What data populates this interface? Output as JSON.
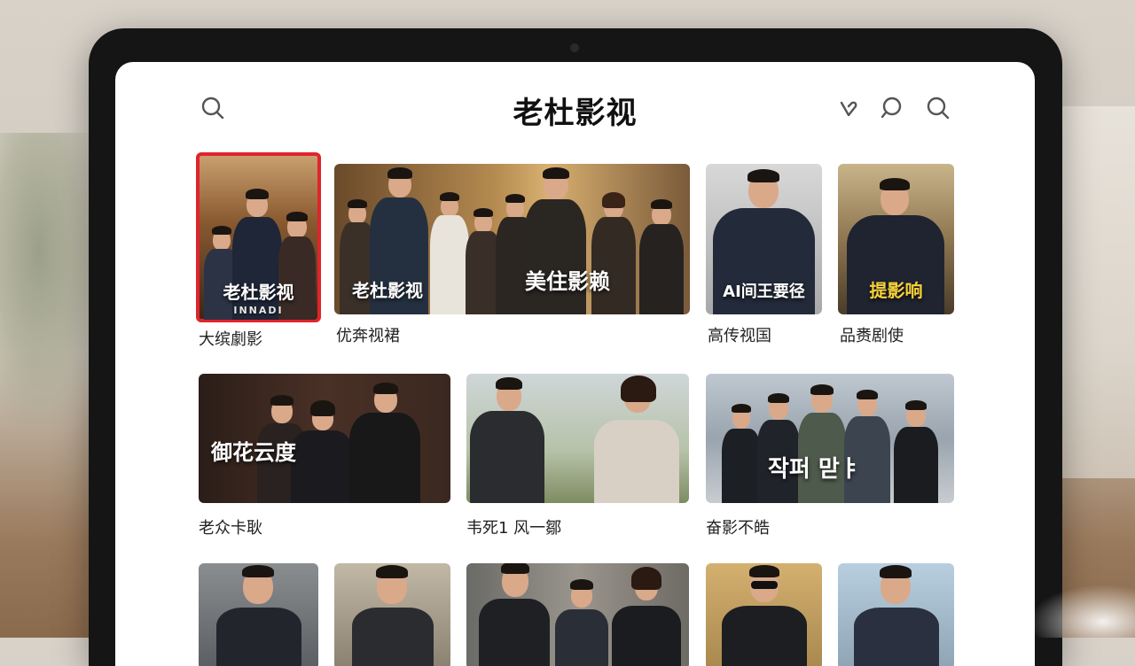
{
  "app": {
    "title": "老杜影视"
  },
  "toolbar": {
    "icons": [
      "search-icon",
      "heart-icon",
      "chat-icon",
      "search-icon"
    ]
  },
  "rows": [
    {
      "cards": [
        {
          "caption": "大缤劇影",
          "poster_title": "老杜影视",
          "poster_sub": "INNADI",
          "selected": true
        },
        {
          "caption": "优奔视裙",
          "poster_title": "老杜影视",
          "poster_title_2": "美住影赖"
        },
        {
          "caption": "高传视国",
          "poster_title": "AI间王要径"
        },
        {
          "caption": "品赉剧使",
          "poster_title": "提影响"
        }
      ]
    },
    {
      "cards": [
        {
          "caption": "老众卡耿",
          "poster_title": "御花云度"
        },
        {
          "caption": "韦死1 风一鄒",
          "poster_title": ""
        },
        {
          "caption": "奋影不皓",
          "poster_title": "작퍼 맏ㅑ"
        }
      ]
    },
    {
      "cards": [
        {
          "caption": ""
        },
        {
          "caption": ""
        },
        {
          "caption": ""
        },
        {
          "caption": ""
        },
        {
          "caption": ""
        }
      ]
    }
  ],
  "colors": {
    "selected_border": "#e0242c",
    "title_text": "#111111",
    "accent_yellow": "#f7d23a"
  }
}
